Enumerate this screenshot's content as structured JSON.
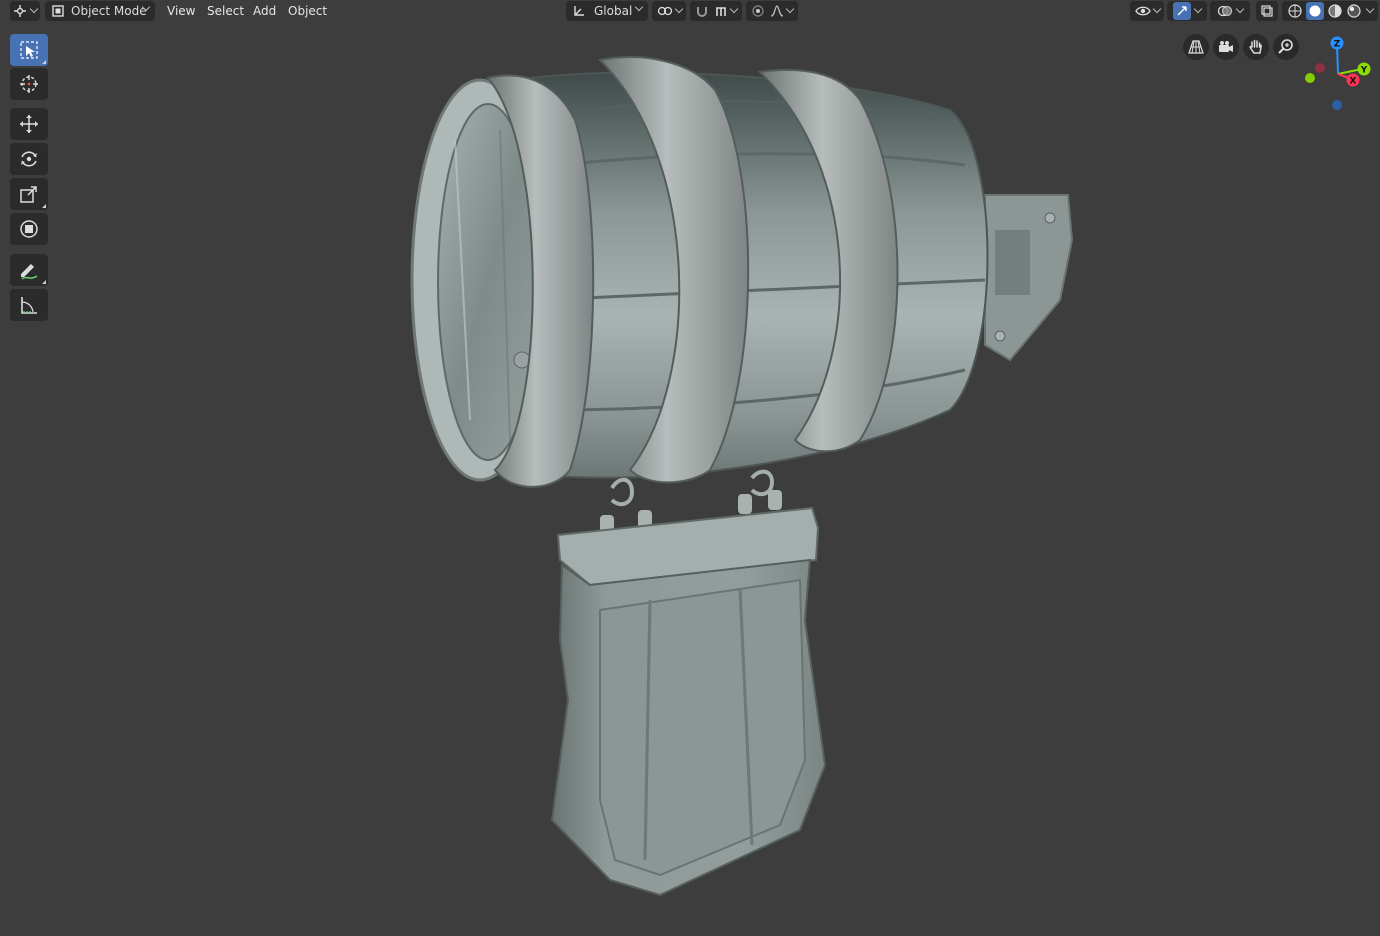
{
  "header": {
    "editor_type_icon": "viewport-editor-icon",
    "mode_label": "Object Mode",
    "menus": [
      "View",
      "Select",
      "Add",
      "Object"
    ],
    "transform_orientation": "Global"
  },
  "toolbar": {
    "tools": [
      {
        "name": "select-box",
        "icon": "select-box-icon",
        "active": true
      },
      {
        "name": "cursor",
        "icon": "cursor-icon",
        "active": false
      },
      {
        "name": "move",
        "icon": "move-icon",
        "active": false
      },
      {
        "name": "rotate",
        "icon": "rotate-icon",
        "active": false
      },
      {
        "name": "scale",
        "icon": "scale-icon",
        "active": false
      },
      {
        "name": "transform",
        "icon": "transform-icon",
        "active": false
      },
      {
        "name": "annotate",
        "icon": "annotate-icon",
        "active": false
      },
      {
        "name": "measure",
        "icon": "measure-icon",
        "active": false
      }
    ]
  },
  "navigation": [
    "perspective-grid-icon",
    "camera-icon",
    "hand-pan-icon",
    "zoom-icon"
  ],
  "gizmo": {
    "z_label": "Z",
    "y_label": "Y",
    "x_label": "X",
    "colors": {
      "x": "#ff3352",
      "y": "#8bdc00",
      "z": "#2890ff"
    }
  },
  "colors": {
    "background": "#3d3d3d",
    "accent": "#4772b3",
    "model_base": "#8f9a98"
  }
}
